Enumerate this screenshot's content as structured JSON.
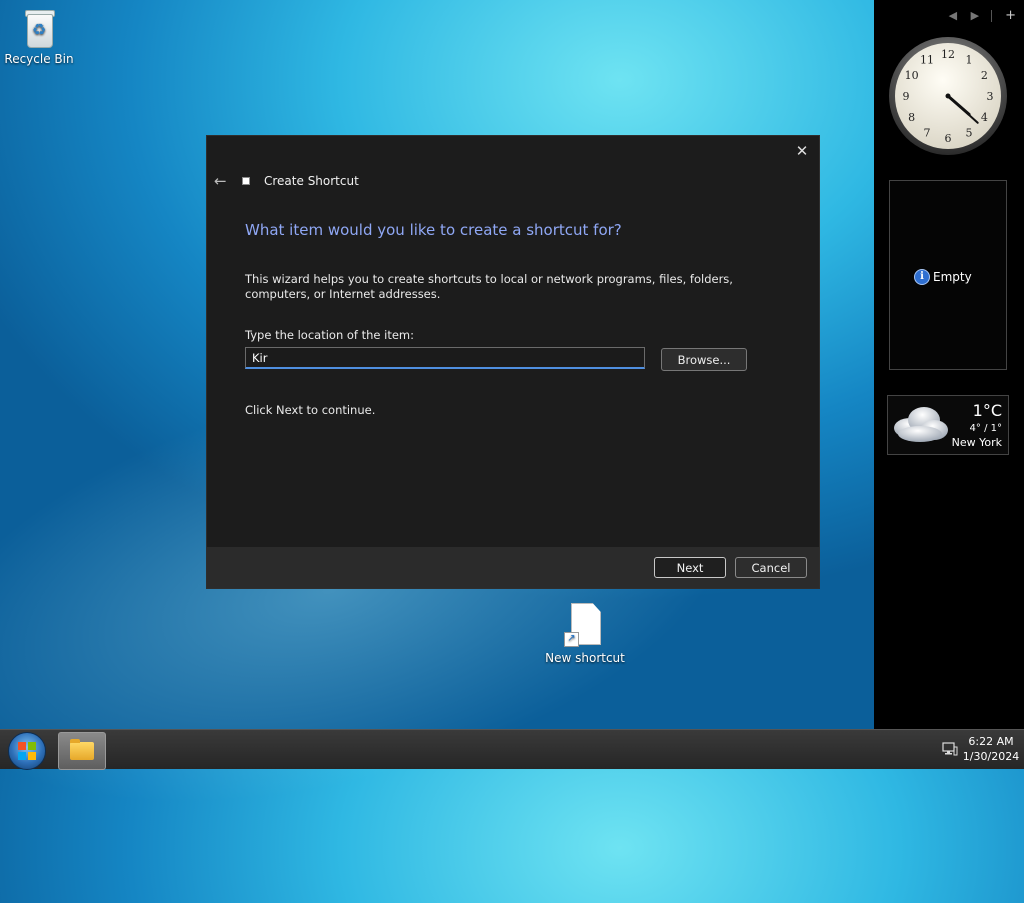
{
  "desktop": {
    "icons": [
      {
        "label": "Recycle Bin",
        "icon": "recycle-bin-icon"
      },
      {
        "label": "New shortcut",
        "icon": "shortcut-file-icon"
      }
    ]
  },
  "sidebar": {
    "controls": {
      "prev": "◀",
      "next": "▶",
      "add": "+"
    },
    "empty_gadget": {
      "label": "Empty"
    },
    "weather": {
      "temperature": "1°C",
      "range": "4° / 1°",
      "city": "New York"
    },
    "clock": {
      "hour": 4,
      "minute": 22
    }
  },
  "dialog": {
    "window_title": "Create Shortcut",
    "close": "✕",
    "back": "←",
    "heading": "What item would you like to create a shortcut for?",
    "description": "This wizard helps you to create shortcuts to local or network programs, files, folders, computers, or Internet addresses.",
    "location_label": "Type the location of the item:",
    "location_value": "Kir",
    "browse_label": "Browse...",
    "hint": "Click Next to continue.",
    "next_label": "Next",
    "cancel_label": "Cancel"
  },
  "taskbar": {
    "time": "6:22 AM",
    "date": "1/30/2024"
  },
  "colors": {
    "heading_accent": "#8fa7f4",
    "input_focus": "#4f8fe0",
    "dialog_bg": "#1c1c1c",
    "footer_bg": "#2b2b2b"
  }
}
